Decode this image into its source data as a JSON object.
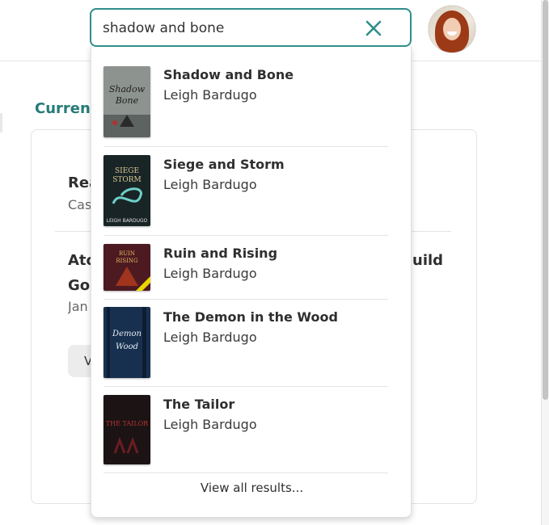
{
  "search": {
    "value": "shadow and bone",
    "placeholder": ""
  },
  "background": {
    "section_heading": "Curren",
    "item1_title": "Rea",
    "item1_subtitle": "Cas",
    "item2_title_line1": "Ato",
    "item2_title_line1_right": "uild",
    "item2_title_line2": "Go",
    "item2_subtitle": "Jan",
    "button_label": "V"
  },
  "results": [
    {
      "title": "Shadow and Bone",
      "author": "Leigh Bardugo",
      "cover_text": "Shadow and Bone",
      "cover_color": "#8f9490"
    },
    {
      "title": "Siege and Storm",
      "author": "Leigh Bardugo",
      "cover_text": "SIEGE and STORM",
      "cover_color": "#1d2a2c"
    },
    {
      "title": "Ruin and Rising",
      "author": "Leigh Bardugo",
      "cover_text": "RUIN and RISING",
      "cover_color": "#5a1c25"
    },
    {
      "title": "The Demon in the Wood",
      "author": "Leigh Bardugo",
      "cover_text": "the Demon in the Wood",
      "cover_color": "#18304f"
    },
    {
      "title": "The Tailor",
      "author": "Leigh Bardugo",
      "cover_text": "THE TAILOR",
      "cover_color": "#1e1416"
    }
  ],
  "view_all_label": "View all results...",
  "colors": {
    "accent": "#2f8e8a",
    "heading_teal": "#267b78"
  },
  "icons": {
    "clear": "close-icon",
    "avatar": "user-avatar"
  }
}
